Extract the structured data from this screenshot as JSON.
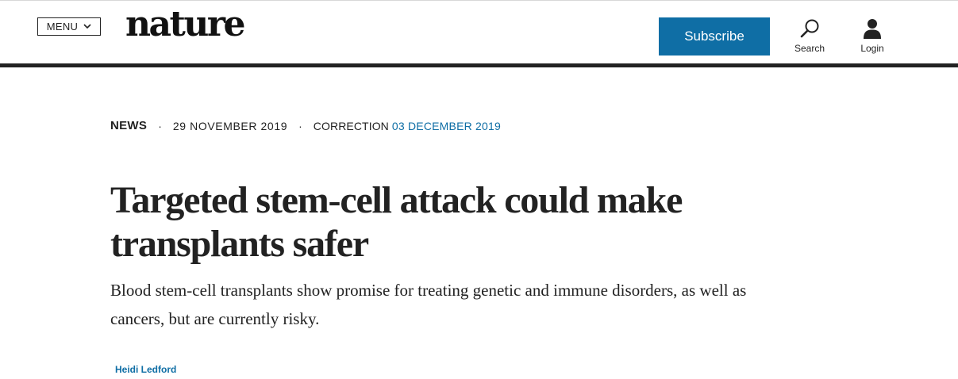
{
  "header": {
    "menu_label": "MENU",
    "logo_text": "nature",
    "subscribe_label": "Subscribe",
    "search_label": "Search",
    "login_label": "Login",
    "accent_color": "#0f6ea5"
  },
  "article": {
    "type": "NEWS",
    "separator": "·",
    "published_date": "29 NOVEMBER 2019",
    "correction_label": "CORRECTION",
    "correction_date": "03 DECEMBER 2019",
    "title": "Targeted stem-cell attack could make transplants safer",
    "standfirst": "Blood stem-cell transplants show promise for treating genetic and immune disorders, as well as cancers, but are currently risky.",
    "author": "Heidi Ledford"
  },
  "icons": {
    "menu": "chevron-down-icon",
    "search": "search-icon",
    "login": "user-icon"
  }
}
